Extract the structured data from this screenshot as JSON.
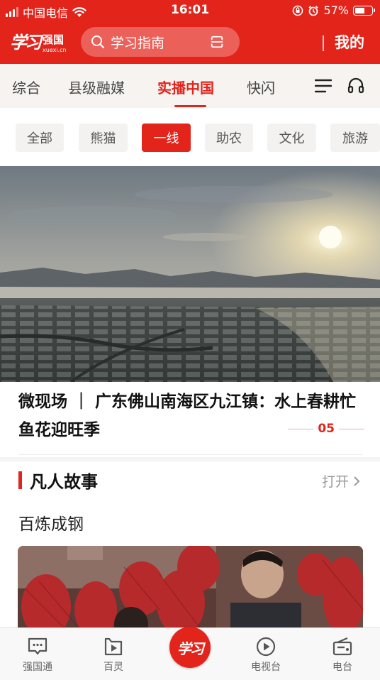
{
  "status_bar": {
    "carrier": "中国电信",
    "time": "16:01",
    "battery": "57%",
    "battery_level": 0.57,
    "icons": [
      "signal-icon",
      "wifi-icon",
      "orientation-lock-icon",
      "alarm-icon",
      "battery-icon"
    ]
  },
  "header": {
    "logo_text": "学习",
    "logo_sub": "强国",
    "logo_url": "xuexi.cn",
    "search_placeholder": "学习指南",
    "mine_label": "我的",
    "icons": [
      "search-icon",
      "scan-icon"
    ]
  },
  "channel_tabs": {
    "items": [
      "综合",
      "县级融媒",
      "实播中国",
      "快闪"
    ],
    "active_index": 2,
    "icons": [
      "menu-icon",
      "headset-icon"
    ]
  },
  "sub_tabs": {
    "items": [
      "全部",
      "熊猫",
      "一线",
      "助农",
      "文化",
      "旅游"
    ],
    "active_index": 2
  },
  "feature": {
    "headline": "微现场 ｜ 广东佛山南海区九江镇：水上春耕忙 鱼花迎旺季",
    "page_indicator": "05"
  },
  "section": {
    "title": "凡人故事",
    "more_label": "打开",
    "item_title": "百炼成钢"
  },
  "bottom_nav": {
    "items": [
      "强国通",
      "百灵",
      "学习",
      "电视台",
      "电台"
    ],
    "center_label": "学习",
    "icons": [
      "chat-icon",
      "bailing-icon",
      "xuexi-logo-icon",
      "tv-play-icon",
      "radio-icon"
    ]
  },
  "colors": {
    "brand_red": "#e3241b",
    "tab_bg": "#f6f3f1",
    "chip_bg": "#f3f2f0"
  }
}
